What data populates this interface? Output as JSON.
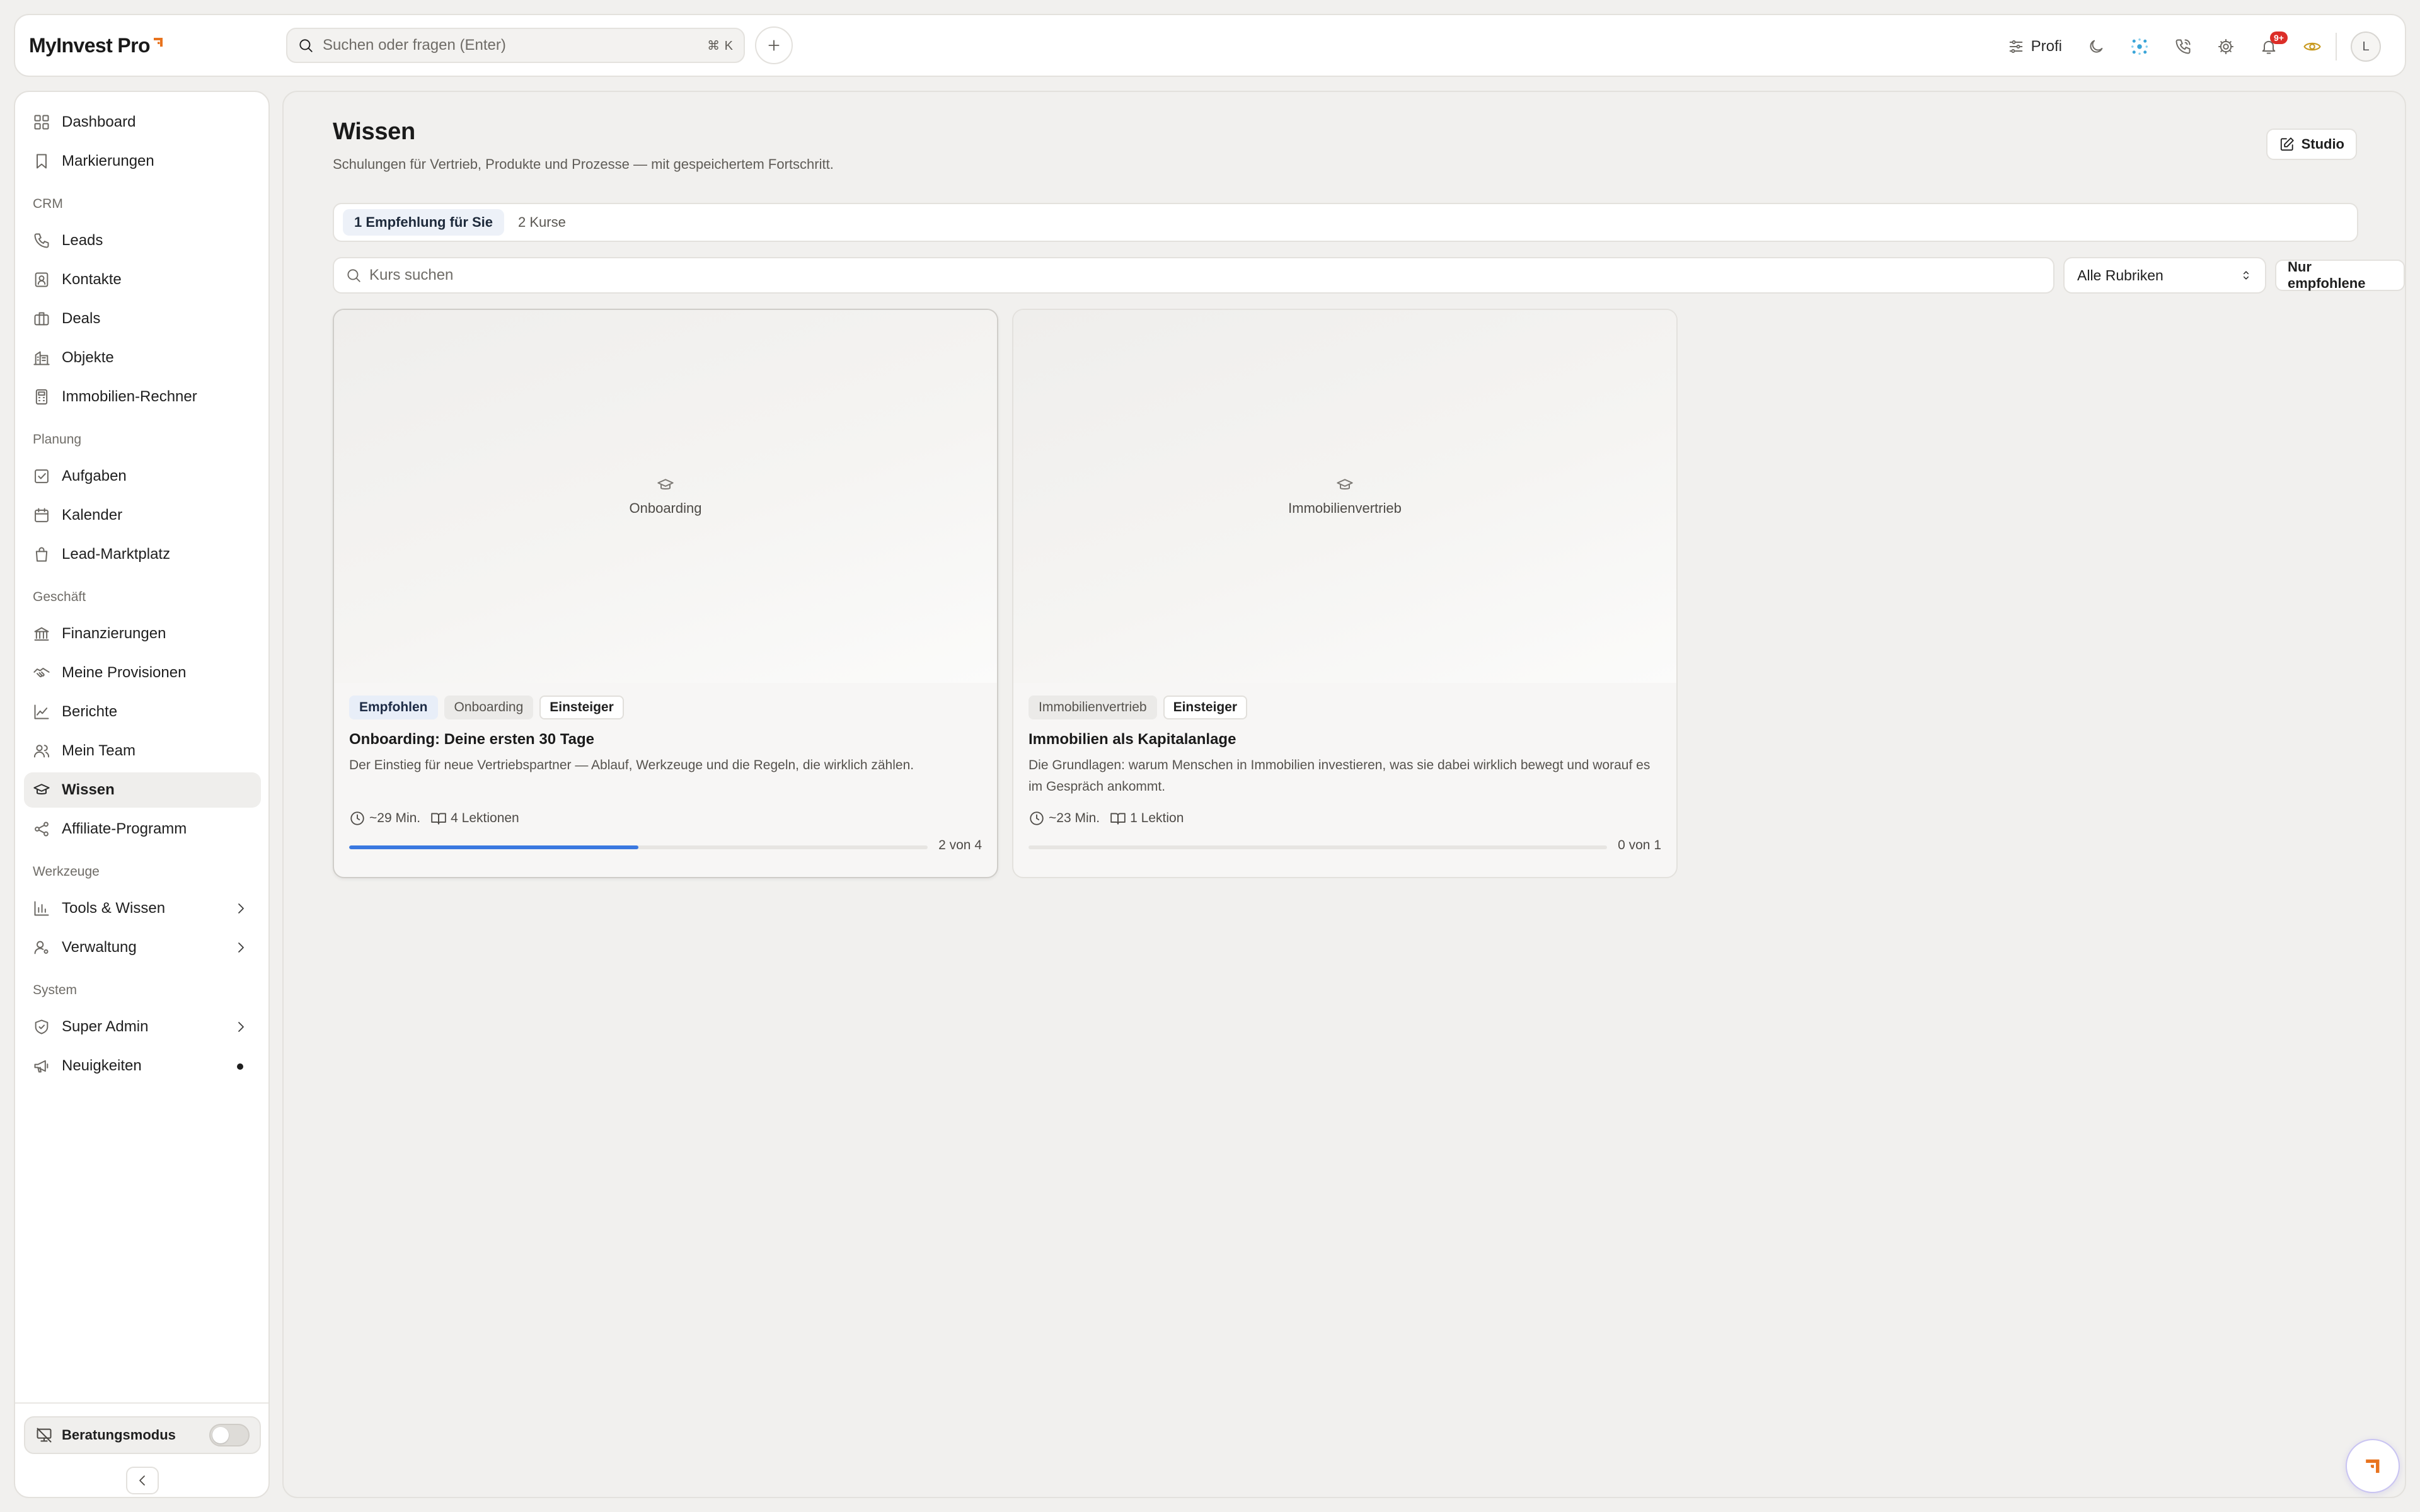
{
  "app": {
    "name": "MyInvest Pro"
  },
  "topbar": {
    "search_placeholder": "Suchen oder fragen (Enter)",
    "shortcut": "⌘ K",
    "profile_mode": "Profi",
    "notifications_badge": "9+",
    "avatar_initial": "L"
  },
  "sidebar": {
    "top_items": [
      {
        "label": "Dashboard",
        "icon": "grid-icon"
      },
      {
        "label": "Markierungen",
        "icon": "bookmark-icon"
      }
    ],
    "sections": [
      {
        "title": "CRM",
        "items": [
          {
            "label": "Leads",
            "icon": "phone-icon"
          },
          {
            "label": "Kontakte",
            "icon": "contact-card-icon"
          },
          {
            "label": "Deals",
            "icon": "briefcase-icon"
          },
          {
            "label": "Objekte",
            "icon": "building-icon"
          },
          {
            "label": "Immobilien-Rechner",
            "icon": "calculator-icon"
          }
        ]
      },
      {
        "title": "Planung",
        "items": [
          {
            "label": "Aufgaben",
            "icon": "checkbox-icon"
          },
          {
            "label": "Kalender",
            "icon": "calendar-icon"
          },
          {
            "label": "Lead-Marktplatz",
            "icon": "shopping-bag-icon"
          }
        ]
      },
      {
        "title": "Geschäft",
        "items": [
          {
            "label": "Finanzierungen",
            "icon": "bank-icon"
          },
          {
            "label": "Meine Provisionen",
            "icon": "handshake-icon"
          },
          {
            "label": "Berichte",
            "icon": "line-chart-icon"
          },
          {
            "label": "Mein Team",
            "icon": "users-icon"
          },
          {
            "label": "Wissen",
            "icon": "graduation-cap-icon",
            "active": true
          },
          {
            "label": "Affiliate-Programm",
            "icon": "share-icon"
          }
        ]
      },
      {
        "title": "Werkzeuge",
        "items": [
          {
            "label": "Tools & Wissen",
            "icon": "bar-chart-icon",
            "chevron": true
          },
          {
            "label": "Verwaltung",
            "icon": "user-cog-icon",
            "chevron": true
          }
        ]
      },
      {
        "title": "System",
        "items": [
          {
            "label": "Super Admin",
            "icon": "shield-icon",
            "chevron": true
          },
          {
            "label": "Neuigkeiten",
            "icon": "megaphone-icon",
            "dot": true
          }
        ]
      }
    ],
    "advice_mode_label": "Beratungsmodus"
  },
  "main": {
    "title": "Wissen",
    "subtitle": "Schulungen für Vertrieb, Produkte und Prozesse — mit gespeichertem Fortschritt.",
    "studio_label": "Studio",
    "tabs": [
      {
        "label": "1 Empfehlung für Sie",
        "active": true
      },
      {
        "label": "2 Kurse",
        "active": false
      }
    ],
    "course_search_placeholder": "Kurs suchen",
    "category_select": "Alle Rubriken",
    "only_recommended_label": "Nur empfohlene",
    "courses": [
      {
        "thumb_caption": "Onboarding",
        "tags": [
          {
            "label": "Empfohlen",
            "style": "blue"
          },
          {
            "label": "Onboarding",
            "style": "grey"
          },
          {
            "label": "Einsteiger",
            "style": "outline"
          }
        ],
        "title": "Onboarding: Deine ersten 30 Tage",
        "description": "Der Einstieg für neue Vertriebspartner — Ablauf, Werkzeuge und die Regeln, die wirklich zählen.",
        "duration": "~29 Min.",
        "lessons": "4 Lektionen",
        "progress_fraction": 0.5,
        "progress_text": "2 von 4"
      },
      {
        "thumb_caption": "Immobilienvertrieb",
        "tags": [
          {
            "label": "Immobilienvertrieb",
            "style": "grey"
          },
          {
            "label": "Einsteiger",
            "style": "outline"
          }
        ],
        "title": "Immobilien als Kapitalanlage",
        "description": "Die Grundlagen: warum Menschen in Immobilien investieren, was sie dabei wirklich bewegt und worauf es im Gespräch ankommt.",
        "duration": "~23 Min.",
        "lessons": "1 Lektion",
        "progress_fraction": 0,
        "progress_text": "0 von 1"
      }
    ]
  },
  "colors": {
    "accent_blue": "#3a78e0",
    "brand_orange": "#e8731e",
    "badge_red": "#dc2e28"
  }
}
